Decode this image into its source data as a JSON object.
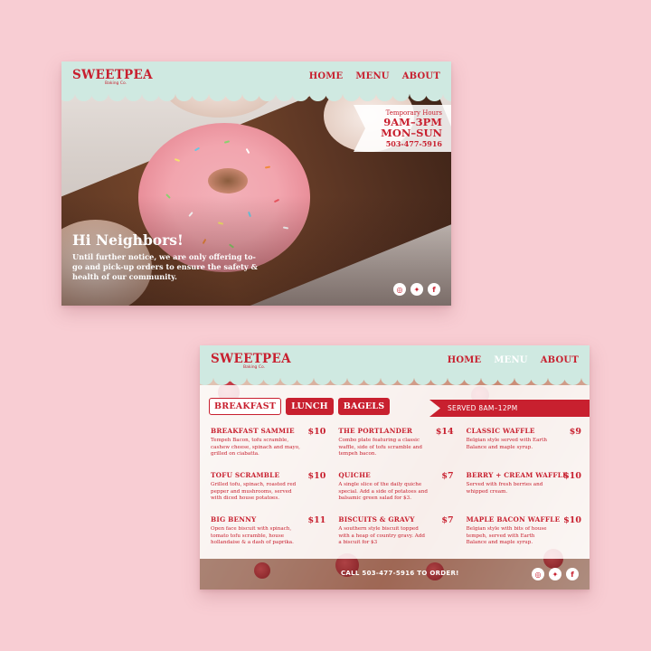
{
  "brand": {
    "name": "SWEETPEA",
    "sub": "Baking Co."
  },
  "nav": [
    "HOME",
    "MENU",
    "ABOUT"
  ],
  "card1": {
    "hours_title": "Temporary Hours",
    "hours_time": "9AM–3PM",
    "hours_days": "MON–SUN",
    "phone": "503-477-5916",
    "heading": "Hi Neighbors!",
    "message": "Until further notice, we are only offering to-go and pick-up orders to ensure the safety & health of our community."
  },
  "social_icons": [
    "instagram-icon",
    "twitter-icon",
    "facebook-icon"
  ],
  "card2": {
    "tabs": [
      "BREAKFAST",
      "LUNCH",
      "BAGELS"
    ],
    "served": "SERVED 8AM–12PM",
    "items": [
      {
        "name": "BREAKFAST SAMMIE",
        "price": "$10",
        "desc": "Tempeh Bacon, tofu scramble, cashew cheese, spinach and mayo, grilled on ciabatta."
      },
      {
        "name": "THE PORTLANDER",
        "price": "$14",
        "desc": "Combo plate featuring a classic waffle, side of tofu scramble and tempeh bacon."
      },
      {
        "name": "CLASSIC WAFFLE",
        "price": "$9",
        "desc": "Belgian style served with Earth Balance and maple syrup."
      },
      {
        "name": "TOFU SCRAMBLE",
        "price": "$10",
        "desc": "Grilled tofu, spinach, roasted red pepper and mushrooms, served with diced house potatoes."
      },
      {
        "name": "QUICHE",
        "price": "$7",
        "desc": "A single slice of the daily quiche special. Add a side of potatoes and balsamic green salad for $3."
      },
      {
        "name": "BERRY + CREAM WAFFLE",
        "price": "$10",
        "desc": "Served with fresh berries and whipped cream."
      },
      {
        "name": "BIG BENNY",
        "price": "$11",
        "desc": "Open face biscuit with spinach, tomato tofu scramble, house hollandaise & a dash of paprika."
      },
      {
        "name": "BISCUITS & GRAVY",
        "price": "$7",
        "desc": "A southern style biscuit topped with a heap of country gravy. Add a biscuit for $3"
      },
      {
        "name": "MAPLE BACON WAFFLE",
        "price": "$10",
        "desc": "Belgian style with bits of house tempeh, served with Earth Balance and maple syrup."
      }
    ],
    "call": "CALL 503-477-5916 TO ORDER!"
  }
}
